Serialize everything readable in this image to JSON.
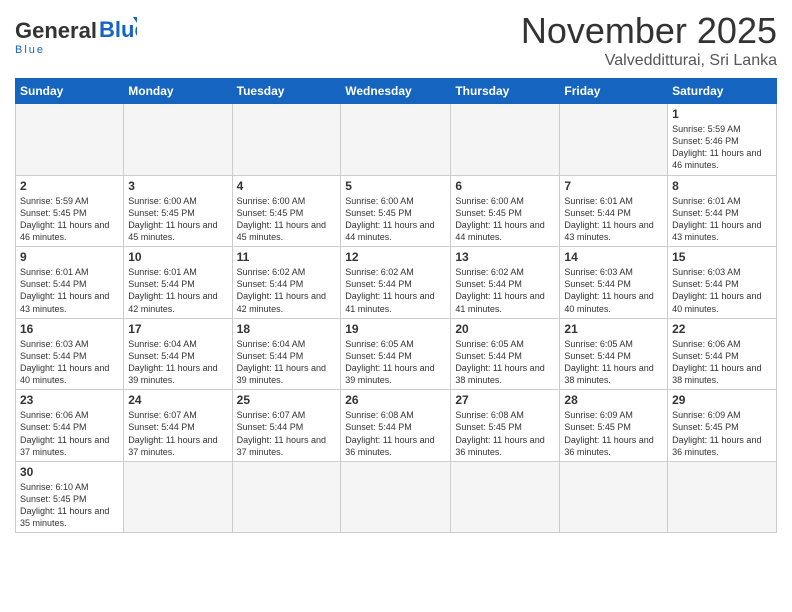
{
  "logo": {
    "general": "General",
    "blue": "Blue",
    "tagline": "Blue"
  },
  "header": {
    "month_year": "November 2025",
    "location": "Valvedditturai, Sri Lanka"
  },
  "days_of_week": [
    "Sunday",
    "Monday",
    "Tuesday",
    "Wednesday",
    "Thursday",
    "Friday",
    "Saturday"
  ],
  "weeks": [
    [
      {
        "day": "",
        "empty": true
      },
      {
        "day": "",
        "empty": true
      },
      {
        "day": "",
        "empty": true
      },
      {
        "day": "",
        "empty": true
      },
      {
        "day": "",
        "empty": true
      },
      {
        "day": "",
        "empty": true
      },
      {
        "day": "1",
        "sunrise": "5:59 AM",
        "sunset": "5:46 PM",
        "daylight": "11 hours and 46 minutes."
      }
    ],
    [
      {
        "day": "2",
        "sunrise": "5:59 AM",
        "sunset": "5:45 PM",
        "daylight": "11 hours and 46 minutes."
      },
      {
        "day": "3",
        "sunrise": "6:00 AM",
        "sunset": "5:45 PM",
        "daylight": "11 hours and 45 minutes."
      },
      {
        "day": "4",
        "sunrise": "6:00 AM",
        "sunset": "5:45 PM",
        "daylight": "11 hours and 45 minutes."
      },
      {
        "day": "5",
        "sunrise": "6:00 AM",
        "sunset": "5:45 PM",
        "daylight": "11 hours and 44 minutes."
      },
      {
        "day": "6",
        "sunrise": "6:00 AM",
        "sunset": "5:45 PM",
        "daylight": "11 hours and 44 minutes."
      },
      {
        "day": "7",
        "sunrise": "6:01 AM",
        "sunset": "5:44 PM",
        "daylight": "11 hours and 43 minutes."
      },
      {
        "day": "8",
        "sunrise": "6:01 AM",
        "sunset": "5:44 PM",
        "daylight": "11 hours and 43 minutes."
      }
    ],
    [
      {
        "day": "9",
        "sunrise": "6:01 AM",
        "sunset": "5:44 PM",
        "daylight": "11 hours and 43 minutes."
      },
      {
        "day": "10",
        "sunrise": "6:01 AM",
        "sunset": "5:44 PM",
        "daylight": "11 hours and 42 minutes."
      },
      {
        "day": "11",
        "sunrise": "6:02 AM",
        "sunset": "5:44 PM",
        "daylight": "11 hours and 42 minutes."
      },
      {
        "day": "12",
        "sunrise": "6:02 AM",
        "sunset": "5:44 PM",
        "daylight": "11 hours and 41 minutes."
      },
      {
        "day": "13",
        "sunrise": "6:02 AM",
        "sunset": "5:44 PM",
        "daylight": "11 hours and 41 minutes."
      },
      {
        "day": "14",
        "sunrise": "6:03 AM",
        "sunset": "5:44 PM",
        "daylight": "11 hours and 40 minutes."
      },
      {
        "day": "15",
        "sunrise": "6:03 AM",
        "sunset": "5:44 PM",
        "daylight": "11 hours and 40 minutes."
      }
    ],
    [
      {
        "day": "16",
        "sunrise": "6:03 AM",
        "sunset": "5:44 PM",
        "daylight": "11 hours and 40 minutes."
      },
      {
        "day": "17",
        "sunrise": "6:04 AM",
        "sunset": "5:44 PM",
        "daylight": "11 hours and 39 minutes."
      },
      {
        "day": "18",
        "sunrise": "6:04 AM",
        "sunset": "5:44 PM",
        "daylight": "11 hours and 39 minutes."
      },
      {
        "day": "19",
        "sunrise": "6:05 AM",
        "sunset": "5:44 PM",
        "daylight": "11 hours and 39 minutes."
      },
      {
        "day": "20",
        "sunrise": "6:05 AM",
        "sunset": "5:44 PM",
        "daylight": "11 hours and 38 minutes."
      },
      {
        "day": "21",
        "sunrise": "6:05 AM",
        "sunset": "5:44 PM",
        "daylight": "11 hours and 38 minutes."
      },
      {
        "day": "22",
        "sunrise": "6:06 AM",
        "sunset": "5:44 PM",
        "daylight": "11 hours and 38 minutes."
      }
    ],
    [
      {
        "day": "23",
        "sunrise": "6:06 AM",
        "sunset": "5:44 PM",
        "daylight": "11 hours and 37 minutes."
      },
      {
        "day": "24",
        "sunrise": "6:07 AM",
        "sunset": "5:44 PM",
        "daylight": "11 hours and 37 minutes."
      },
      {
        "day": "25",
        "sunrise": "6:07 AM",
        "sunset": "5:44 PM",
        "daylight": "11 hours and 37 minutes."
      },
      {
        "day": "26",
        "sunrise": "6:08 AM",
        "sunset": "5:44 PM",
        "daylight": "11 hours and 36 minutes."
      },
      {
        "day": "27",
        "sunrise": "6:08 AM",
        "sunset": "5:45 PM",
        "daylight": "11 hours and 36 minutes."
      },
      {
        "day": "28",
        "sunrise": "6:09 AM",
        "sunset": "5:45 PM",
        "daylight": "11 hours and 36 minutes."
      },
      {
        "day": "29",
        "sunrise": "6:09 AM",
        "sunset": "5:45 PM",
        "daylight": "11 hours and 36 minutes."
      }
    ],
    [
      {
        "day": "30",
        "sunrise": "6:10 AM",
        "sunset": "5:45 PM",
        "daylight": "11 hours and 35 minutes."
      },
      {
        "day": "",
        "empty": true
      },
      {
        "day": "",
        "empty": true
      },
      {
        "day": "",
        "empty": true
      },
      {
        "day": "",
        "empty": true
      },
      {
        "day": "",
        "empty": true
      },
      {
        "day": "",
        "empty": true
      }
    ]
  ]
}
